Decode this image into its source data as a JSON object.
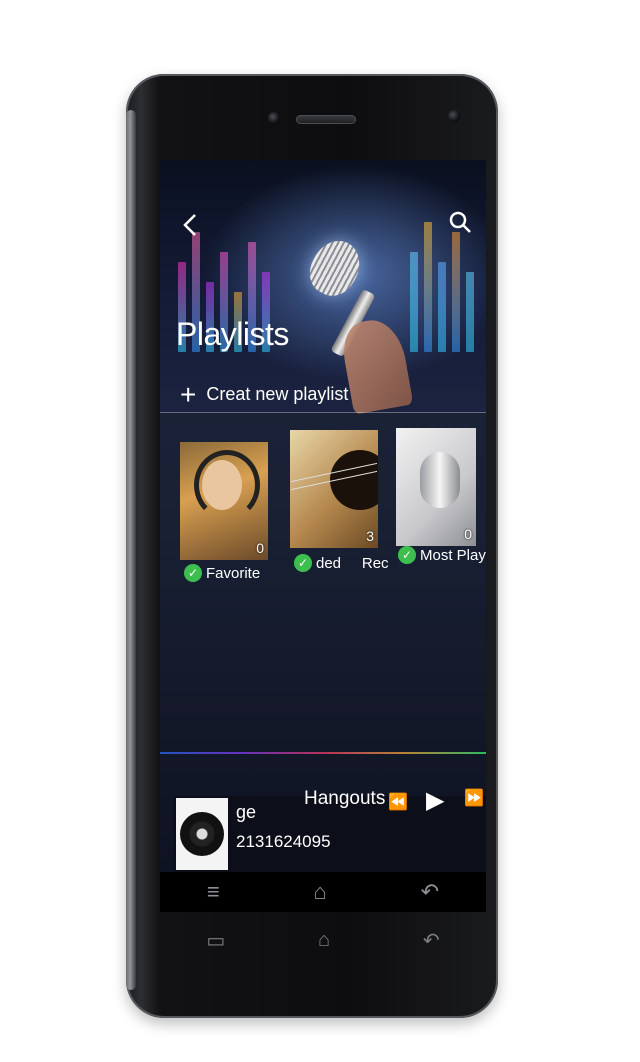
{
  "screen": {
    "title": "Playlists",
    "create_label": "Creat new playlist",
    "icons": {
      "back": "back-arrow-icon",
      "search": "search-icon",
      "add": "plus-icon"
    },
    "playlists": [
      {
        "name": "Favorite",
        "count": "0"
      },
      {
        "name": "ded     Rec",
        "count": "3"
      },
      {
        "name": "Most Playe",
        "count": "0"
      }
    ],
    "player": {
      "song": "ge",
      "artist": "Hangouts",
      "number": "2131624095",
      "controls": {
        "prev": "⏪",
        "play": "▶",
        "next": "⏩"
      }
    },
    "nav": {
      "menu": "≡",
      "home": "⌂",
      "back": "↶"
    }
  },
  "colors": {
    "accent_check": "#3cbf4e",
    "screen_bg": "#1a2135"
  }
}
